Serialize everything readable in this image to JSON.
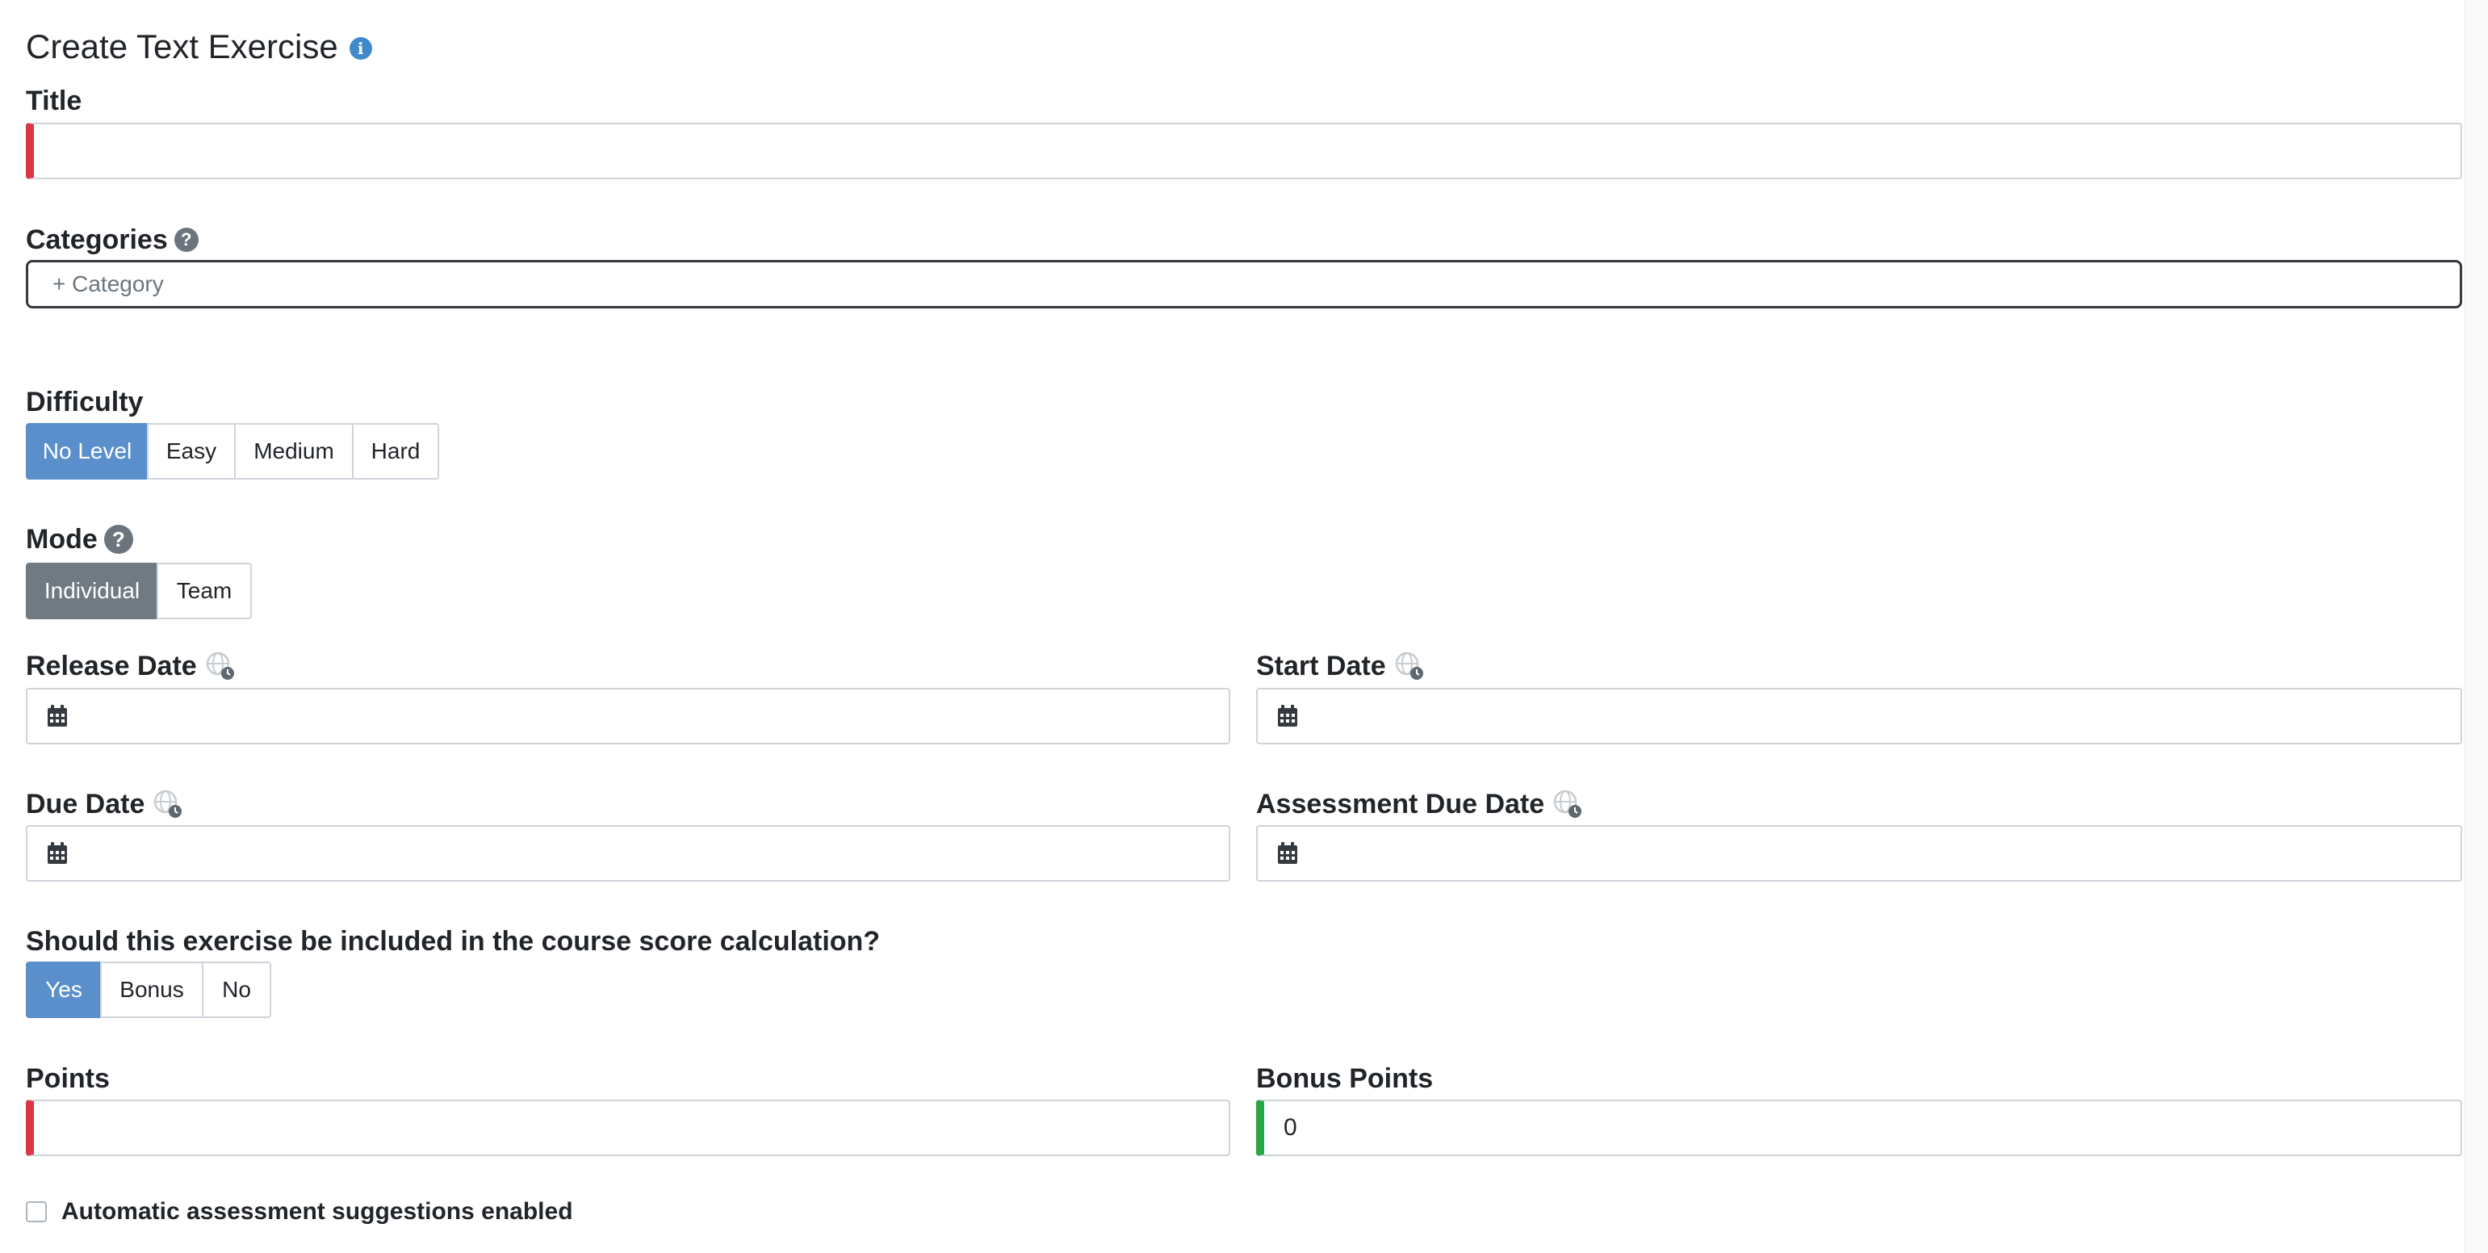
{
  "header": {
    "title": "Create Text Exercise",
    "info_icon": "info-icon"
  },
  "title_field": {
    "label": "Title",
    "value": "",
    "status": "invalid"
  },
  "categories": {
    "label": "Categories",
    "placeholder": "+ Category"
  },
  "difficulty": {
    "label": "Difficulty",
    "options": [
      "No Level",
      "Easy",
      "Medium",
      "Hard"
    ],
    "selected": "No Level"
  },
  "mode": {
    "label": "Mode",
    "options": [
      "Individual",
      "Team"
    ],
    "selected": "Individual"
  },
  "dates": {
    "release_label": "Release Date",
    "start_label": "Start Date",
    "due_label": "Due Date",
    "assessment_due_label": "Assessment Due Date"
  },
  "course_score": {
    "label": "Should this exercise be included in the course score calculation?",
    "options": [
      "Yes",
      "Bonus",
      "No"
    ],
    "selected": "Yes"
  },
  "points": {
    "label": "Points",
    "value": "",
    "status": "invalid"
  },
  "bonus_points": {
    "label": "Bonus Points",
    "value": "0",
    "status": "valid"
  },
  "auto_assessment": {
    "label": "Automatic assessment suggestions enabled",
    "checked": false
  },
  "colors": {
    "primary": "#5a8fcb",
    "secondary": "#707a83",
    "invalid": "#dc3545",
    "valid": "#28a745",
    "info": "#3e8acc"
  }
}
